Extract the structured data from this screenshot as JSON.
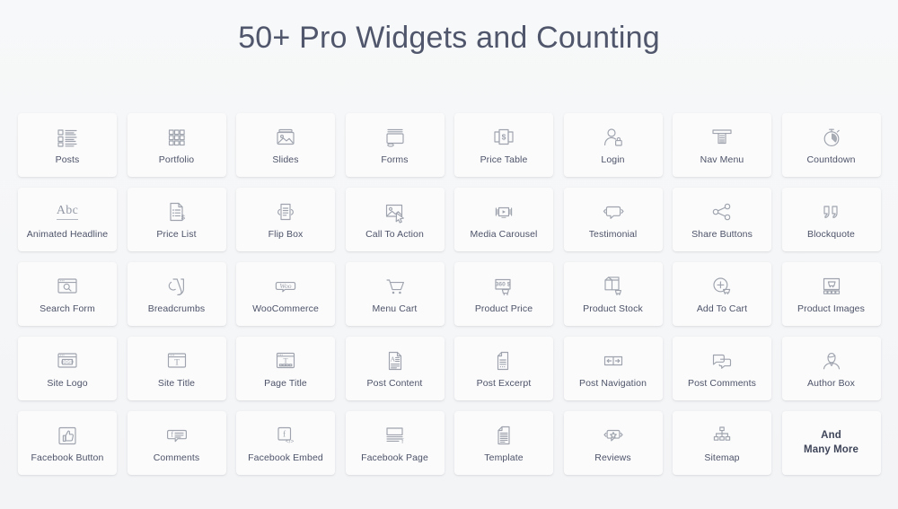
{
  "header": {
    "title": "50+ Pro Widgets and Counting"
  },
  "colors": {
    "background": "#f5f6f7",
    "card_background": "#fbfbfc",
    "title_text": "#50566b",
    "label_text": "#4d5368",
    "icon_stroke": "#9ea3ad"
  },
  "widgets": [
    {
      "label": "Posts",
      "icon": "posts-icon"
    },
    {
      "label": "Portfolio",
      "icon": "portfolio-grid-icon"
    },
    {
      "label": "Slides",
      "icon": "slides-image-icon"
    },
    {
      "label": "Forms",
      "icon": "forms-monitor-icon"
    },
    {
      "label": "Price Table",
      "icon": "price-table-dollar-icon"
    },
    {
      "label": "Login",
      "icon": "login-user-lock-icon"
    },
    {
      "label": "Nav Menu",
      "icon": "nav-menu-icon"
    },
    {
      "label": "Countdown",
      "icon": "countdown-stopwatch-icon"
    },
    {
      "label": "Animated Headline",
      "icon": "animated-headline-abc-icon"
    },
    {
      "label": "Price List",
      "icon": "price-list-document-icon"
    },
    {
      "label": "Flip Box",
      "icon": "flip-box-icon"
    },
    {
      "label": "Call To Action",
      "icon": "call-to-action-cursor-icon"
    },
    {
      "label": "Media Carousel",
      "icon": "media-carousel-play-icon"
    },
    {
      "label": "Testimonial",
      "icon": "testimonial-quote-bubble-icon"
    },
    {
      "label": "Share Buttons",
      "icon": "share-nodes-icon"
    },
    {
      "label": "Blockquote",
      "icon": "blockquote-quotes-icon"
    },
    {
      "label": "Search Form",
      "icon": "search-form-magnifier-icon"
    },
    {
      "label": "Breadcrumbs",
      "icon": "breadcrumbs-yoast-icon"
    },
    {
      "label": "WooCommerce",
      "icon": "woocommerce-icon"
    },
    {
      "label": "Menu Cart",
      "icon": "menu-cart-icon"
    },
    {
      "label": "Product Price",
      "icon": "product-price-tag-icon"
    },
    {
      "label": "Product Stock",
      "icon": "product-stock-box-icon"
    },
    {
      "label": "Add To Cart",
      "icon": "add-to-cart-plus-icon"
    },
    {
      "label": "Product Images",
      "icon": "product-images-gallery-icon"
    },
    {
      "label": "Site Logo",
      "icon": "site-logo-browser-icon"
    },
    {
      "label": "Site Title",
      "icon": "site-title-browser-t-icon"
    },
    {
      "label": "Page Title",
      "icon": "page-title-browser-t-icon"
    },
    {
      "label": "Post Content",
      "icon": "post-content-document-a-icon"
    },
    {
      "label": "Post Excerpt",
      "icon": "post-excerpt-document-icon"
    },
    {
      "label": "Post Navigation",
      "icon": "post-navigation-arrows-icon"
    },
    {
      "label": "Post Comments",
      "icon": "post-comments-bubbles-icon"
    },
    {
      "label": "Author Box",
      "icon": "author-box-person-icon"
    },
    {
      "label": "Facebook Button",
      "icon": "facebook-thumbs-up-icon"
    },
    {
      "label": "Comments",
      "icon": "comments-f-bubble-icon"
    },
    {
      "label": "Facebook Embed",
      "icon": "facebook-embed-code-icon"
    },
    {
      "label": "Facebook Page",
      "icon": "facebook-page-icon"
    },
    {
      "label": "Template",
      "icon": "template-document-icon"
    },
    {
      "label": "Reviews",
      "icon": "reviews-star-bubble-icon"
    },
    {
      "label": "Sitemap",
      "icon": "sitemap-hierarchy-icon"
    },
    {
      "label": "And\nMany More",
      "icon": "none",
      "is_last": true
    }
  ]
}
